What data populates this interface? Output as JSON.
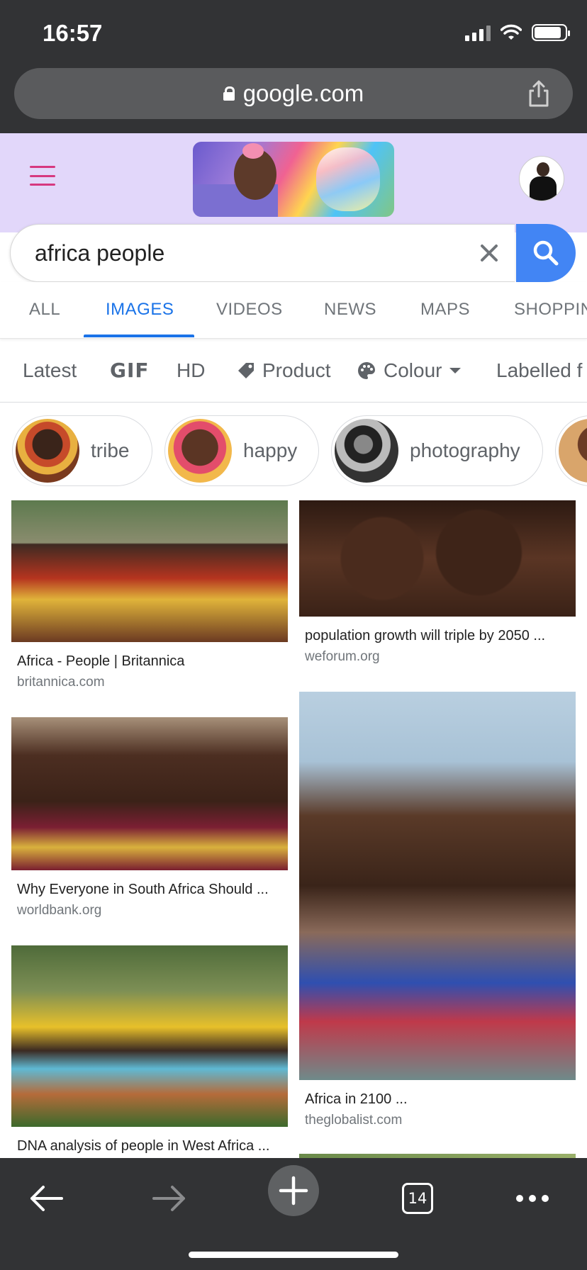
{
  "status_bar": {
    "time": "16:57"
  },
  "browser": {
    "url": "google.com"
  },
  "search": {
    "query": "africa people"
  },
  "tabs": [
    {
      "label": "ALL",
      "active": false
    },
    {
      "label": "IMAGES",
      "active": true
    },
    {
      "label": "VIDEOS",
      "active": false
    },
    {
      "label": "NEWS",
      "active": false
    },
    {
      "label": "MAPS",
      "active": false
    },
    {
      "label": "SHOPPIN",
      "active": false
    }
  ],
  "filters": {
    "latest": "Latest",
    "gif": "GIF",
    "hd": "HD",
    "product": "Product",
    "colour": "Colour",
    "labelled": "Labelled f"
  },
  "chips": [
    {
      "label": "tribe"
    },
    {
      "label": "happy"
    },
    {
      "label": "photography"
    }
  ],
  "results": [
    {
      "title": "Africa - People | Britannica",
      "source": "britannica.com"
    },
    {
      "title": "population growth will triple by 2050 ...",
      "source": "weforum.org"
    },
    {
      "title": "Why Everyone in South Africa Should ...",
      "source": "worldbank.org"
    },
    {
      "title": "Africa in 2100 ...",
      "source": "theglobalist.com"
    },
    {
      "title": "DNA analysis of people in West Africa ...",
      "source": ""
    }
  ],
  "bottom_toolbar": {
    "tab_count": "14"
  },
  "colors": {
    "chrome": "#323335",
    "doodle_bg": "#e2d7fa",
    "accent_blue": "#1a73e8",
    "search_button": "#4285f4",
    "menu_pink": "#d6387f"
  },
  "icons": [
    "lock-icon",
    "share-icon",
    "menu-icon",
    "clear-icon",
    "search-icon",
    "tag-icon",
    "palette-icon",
    "chevron-down-icon",
    "back-icon",
    "forward-icon",
    "plus-icon",
    "more-icon"
  ]
}
